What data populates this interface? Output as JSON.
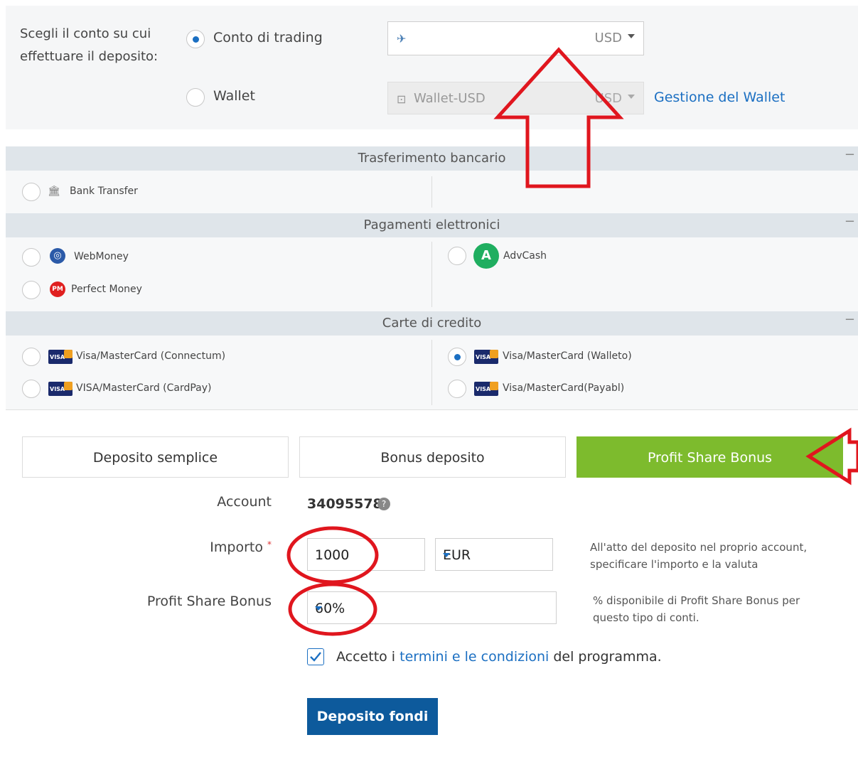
{
  "account_select": {
    "label": "Scegli il conto su cui effettuare il deposito:",
    "options": [
      {
        "label": "Conto di trading",
        "selected": true,
        "currency": "USD",
        "value": ""
      },
      {
        "label": "Wallet",
        "selected": false,
        "currency": "USD",
        "value": "Wallet-USD"
      }
    ],
    "wallet_link": "Gestione del Wallet"
  },
  "sections": {
    "bank": {
      "title": "Trasferimento bancario",
      "collapse": "−",
      "methods": [
        {
          "label": "Bank Transfer",
          "selected": false
        }
      ]
    },
    "electronic": {
      "title": "Pagamenti elettronici",
      "collapse": "−",
      "methods": [
        {
          "label": "WebMoney",
          "selected": false
        },
        {
          "label": "Perfect Money",
          "selected": false
        },
        {
          "label": "AdvCash",
          "selected": false
        }
      ]
    },
    "cards": {
      "title": "Carte di credito",
      "collapse": "−",
      "methods": [
        {
          "label": "Visa/MasterCard (Connectum)",
          "selected": false
        },
        {
          "label": "VISA/MasterCard (CardPay)",
          "selected": false
        },
        {
          "label": "Visa/MasterCard (Walleto)",
          "selected": true
        },
        {
          "label": "Visa/MasterCard(Payabl)",
          "selected": false
        }
      ]
    }
  },
  "tabs": [
    {
      "label": "Deposito semplice",
      "active": false
    },
    {
      "label": "Bonus deposito",
      "active": false
    },
    {
      "label": "Profit Share Bonus",
      "active": true
    }
  ],
  "form": {
    "account_label": "Account",
    "account_value": "34095578",
    "amount_label": "Importo",
    "required_mark": "*",
    "amount_value": "1000",
    "currency_value": "EUR",
    "amount_hint": "All'atto del deposito nel proprio account, specificare l'importo e la valuta",
    "bonus_label": "Profit Share Bonus",
    "bonus_value": "60%",
    "bonus_hint": "% disponibile di Profit Share Bonus per questo tipo di conti.",
    "terms_prefix": "Accetto i ",
    "terms_link": "termini e le condizioni",
    "terms_suffix": " del programma.",
    "terms_checked": true,
    "submit_label": "Deposito fondi"
  },
  "colors": {
    "accent_green": "#7dbb2d",
    "primary_blue": "#0d5a9c",
    "link_blue": "#1b6fc2",
    "annotation_red": "#e0161e"
  }
}
